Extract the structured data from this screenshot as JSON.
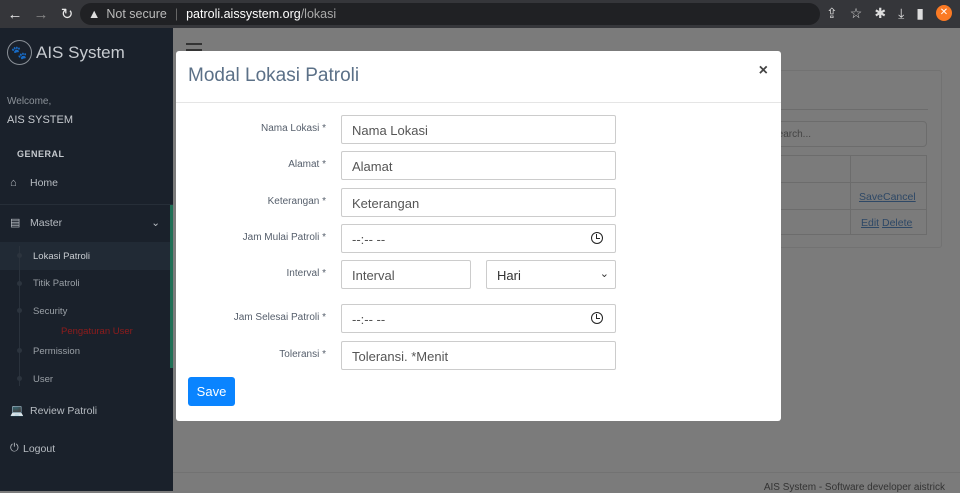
{
  "browser": {
    "security": "Not secure",
    "host": "patroli.aissystem.org",
    "path": "/lokasi"
  },
  "sidebar": {
    "brand": "AIS System",
    "welcome": "Welcome,",
    "user": "AIS SYSTEM",
    "section": "GENERAL",
    "home": "Home",
    "master": "Master",
    "sub": [
      "Lokasi Patroli",
      "Titik Patroli",
      "Security",
      "Permission",
      "User"
    ],
    "group_label": "Pengaturan User",
    "review": "Review Patroli",
    "logout": "Logout"
  },
  "background": {
    "search_placeholder": "Search...",
    "row1": [
      "Save",
      "Cancel"
    ],
    "row2": [
      "Edit",
      "Delete"
    ],
    "footer": "AIS System - Software developer aistrick"
  },
  "modal": {
    "title": "Modal Lokasi Patroli",
    "close": "×",
    "fields": {
      "nama": {
        "label": "Nama Lokasi *",
        "placeholder": "Nama Lokasi"
      },
      "alamat": {
        "label": "Alamat *",
        "placeholder": "Alamat"
      },
      "keterangan": {
        "label": "Keterangan *",
        "placeholder": "Keterangan"
      },
      "jam_mulai": {
        "label": "Jam Mulai Patroli *",
        "value": "--:-- --"
      },
      "interval": {
        "label": "Interval *",
        "placeholder": "Interval",
        "unit": "Hari"
      },
      "jam_selesai": {
        "label": "Jam Selesai Patroli *",
        "value": "--:-- --"
      },
      "toleransi": {
        "label": "Toleransi *",
        "placeholder": "Toleransi. *Menit"
      }
    },
    "save": "Save"
  }
}
